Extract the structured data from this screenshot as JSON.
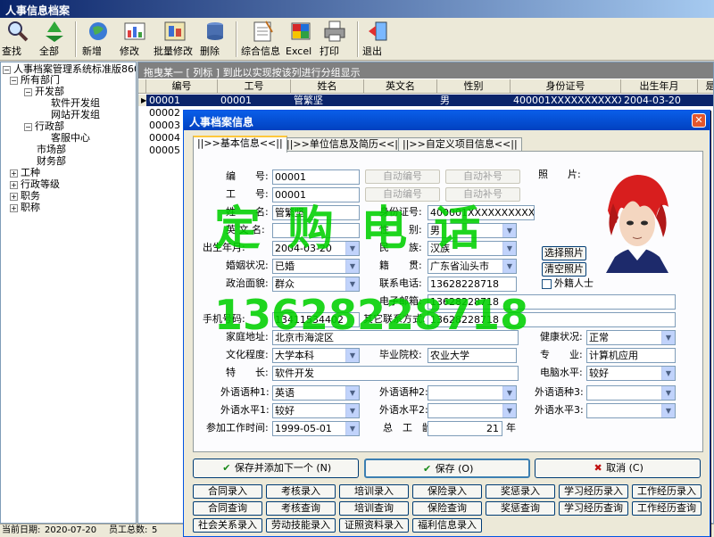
{
  "window": {
    "title": "人事信息档案"
  },
  "toolbar": {
    "search": "查找",
    "all": "全部",
    "add": "新增",
    "edit": "修改",
    "batch_edit": "批量修改",
    "delete": "删除",
    "summary": "综合信息",
    "excel": "Excel",
    "print": "打印",
    "exit": "退出"
  },
  "tree": {
    "root": "人事档案管理系统标准版860-",
    "all_depts": "所有部门",
    "dev_dept": "开发部",
    "software_group": "软件开发组",
    "web_group": "网站开发组",
    "admin_dept": "行政部",
    "service_center": "客服中心",
    "market_dept": "市场部",
    "finance_dept": "财务部",
    "job_type": "工种",
    "admin_level": "行政等级",
    "position": "职务",
    "title": "职称"
  },
  "grid": {
    "group_hint": "拖曳某一 [ 列标 ] 到此以实现按该列进行分组显示",
    "columns": [
      "编号",
      "工号",
      "姓名",
      "英文名",
      "性别",
      "身份证号",
      "出生年月",
      "是否"
    ],
    "rows": [
      [
        "00001",
        "00001",
        "管繁坚",
        "",
        "男",
        "400001XXXXXXXXXXXXX",
        "2004-03-20"
      ],
      [
        "00002",
        "",
        "",
        "",
        "",
        "",
        ""
      ],
      [
        "00003",
        "",
        "",
        "",
        "",
        "",
        ""
      ],
      [
        "00004",
        "",
        "",
        "",
        "",
        "",
        ""
      ],
      [
        "00005",
        "",
        "",
        "",
        "",
        "",
        ""
      ]
    ]
  },
  "statusbar": {
    "date_label": "当前日期:",
    "date": "2020-07-20",
    "total_label": "员工总数:",
    "total": "5"
  },
  "dialog": {
    "title": "人事档案信息",
    "tabs": [
      "||>>基本信息<<||",
      "||>>单位信息及简历<<||",
      "||>>自定义项目信息<<||"
    ],
    "fields": {
      "id_label": "编　　号:",
      "id_value": "00001",
      "empno_label": "工　　号:",
      "empno_value": "00001",
      "name_label": "姓　　名:",
      "name_value": "管繁坚",
      "idcard_label": "身份证号:",
      "idcard_value": "400001XXXXXXXXXXXXX",
      "engname_label": "英 文 名:",
      "engname_value": "",
      "gender_label": "性　　别:",
      "gender_value": "男",
      "birth_label": "出生年月:",
      "birth_value": "2004-03-20",
      "nation_label": "民　　族:",
      "nation_value": "汉族",
      "marital_label": "婚姻状况:",
      "marital_value": "已婚",
      "native_label": "籍　　贯:",
      "native_value": "广东省汕头市",
      "political_label": "政治面貌:",
      "political_value": "群众",
      "phone_label": "联系电话:",
      "phone_value": "13628228718",
      "email_label": "电子邮箱:",
      "email_value": "13628228718",
      "mobile_label": "手机号码:",
      "mobile_value": "13411534402",
      "other_contact_label": "其它联系方式:",
      "other_contact_value": "13628228718",
      "address_label": "家庭地址:",
      "address_value": "北京市海淀区",
      "health_label": "健康状况:",
      "health_value": "正常",
      "edu_label": "文化程度:",
      "edu_value": "大学本科",
      "school_label": "毕业院校:",
      "school_value": "农业大学",
      "major_label": "专　　业:",
      "major_value": "计算机应用",
      "skill_label": "特　　长:",
      "skill_value": "软件开发",
      "pc_label": "电脑水平:",
      "pc_value": "较好",
      "lang1_label": "外语语种1:",
      "lang1_value": "英语",
      "lang2_label": "外语语种2:",
      "lang2_value": "",
      "lang3_label": "外语语种3:",
      "lang3_value": "",
      "level1_label": "外语水平1:",
      "level1_value": "较好",
      "level2_label": "外语水平2:",
      "level2_value": "",
      "level3_label": "外语水平3:",
      "level3_value": "",
      "workstart_label": "参加工作时间:",
      "workstart_value": "1999-05-01",
      "seniority_label": "总　工　龄:",
      "seniority_value": "21",
      "year_unit": "年",
      "photo_label": "照　　片:",
      "foreigner_label": "外籍人士"
    },
    "buttons": {
      "auto_id": "自动编号",
      "auto_fill": "自动补号",
      "auto_id2": "自动编号",
      "auto_fill2": "自动补号",
      "choose_photo": "选择照片",
      "clear_photo": "清空照片",
      "save_add": "保存并添加下一个 (N)",
      "save": "保存 (O)",
      "cancel": "取消 (C)"
    },
    "module_buttons": [
      "合同录入",
      "考核录入",
      "培训录入",
      "保险录入",
      "奖惩录入",
      "学习经历录入",
      "工作经历录入",
      "合同查询",
      "考核查询",
      "培训查询",
      "保险查询",
      "奖惩查询",
      "学习经历查询",
      "工作经历查询",
      "社会关系录入",
      "劳动技能录入",
      "证照资料录入",
      "福利信息录入"
    ]
  },
  "watermark": {
    "line1": "定 购 电 话",
    "line2": "13628228718"
  },
  "colors": {
    "accent": "#0a246a",
    "watermark": "#00d000"
  }
}
